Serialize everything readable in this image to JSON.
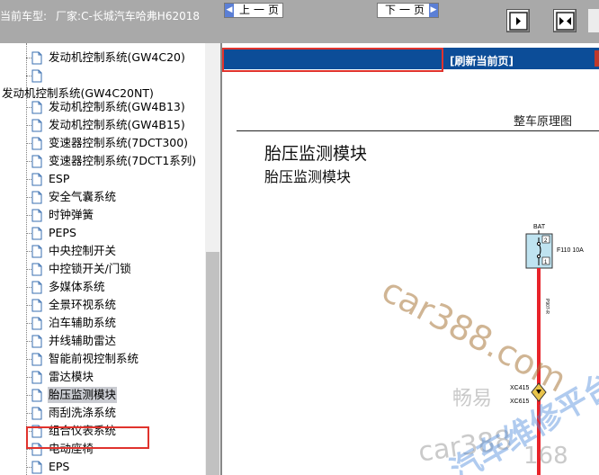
{
  "header": {
    "label": "当前车型:",
    "value": "厂家:C-长城汽车哈弗H62018"
  },
  "tree": {
    "items_above": [
      {
        "label": "发动机控制系统(GW4C20)"
      },
      {
        "label": ""
      }
    ],
    "parent_label": "发动机控制系统(GW4C20NT)",
    "items": [
      {
        "label": "发动机控制系统(GW4B13)"
      },
      {
        "label": "发动机控制系统(GW4B15)"
      },
      {
        "label": "变速器控制系统(7DCT300)"
      },
      {
        "label": "变速器控制系统(7DCT1系列)"
      },
      {
        "label": "ESP"
      },
      {
        "label": "安全气囊系统"
      },
      {
        "label": "时钟弹簧"
      },
      {
        "label": "PEPS"
      },
      {
        "label": "中央控制开关"
      },
      {
        "label": "中控锁开关/门锁"
      },
      {
        "label": "多媒体系统"
      },
      {
        "label": "全景环视系统"
      },
      {
        "label": "泊车辅助系统"
      },
      {
        "label": "并线辅助雷达"
      },
      {
        "label": "智能前视控制系统"
      },
      {
        "label": "雷达模块"
      },
      {
        "label": "胎压监测模块",
        "selected": true
      },
      {
        "label": "雨刮洗涤系统"
      },
      {
        "label": "组合仪表系统"
      },
      {
        "label": "电动座椅"
      },
      {
        "label": "EPS"
      }
    ]
  },
  "nav": {
    "prev_label": "上一页",
    "next_label": "下一页",
    "refresh_label": "[刷新当前页]"
  },
  "document": {
    "header_right": "整车原理图",
    "title": "胎压监测模块",
    "subtitle": "胎压监测模块",
    "diagram": {
      "bat_label": "BAT",
      "fuse_label": "F110 10A",
      "pin_top": "2",
      "pin_bottom": "1",
      "wire_label": "P907-R",
      "connector1": "XC415",
      "connector2": "XC615"
    },
    "watermarks": {
      "wm1": "car388.com",
      "wm2": "畅易",
      "wm3": "car388",
      "wm4": "汽车维修平台",
      "wm5": "168"
    }
  },
  "colors": {
    "topbar": "#a9a9a9",
    "navbar": "#0c4d98",
    "highlight_box": "#e0332d",
    "wire_red": "#e8232a",
    "selected_bg": "#c9cbd1"
  }
}
